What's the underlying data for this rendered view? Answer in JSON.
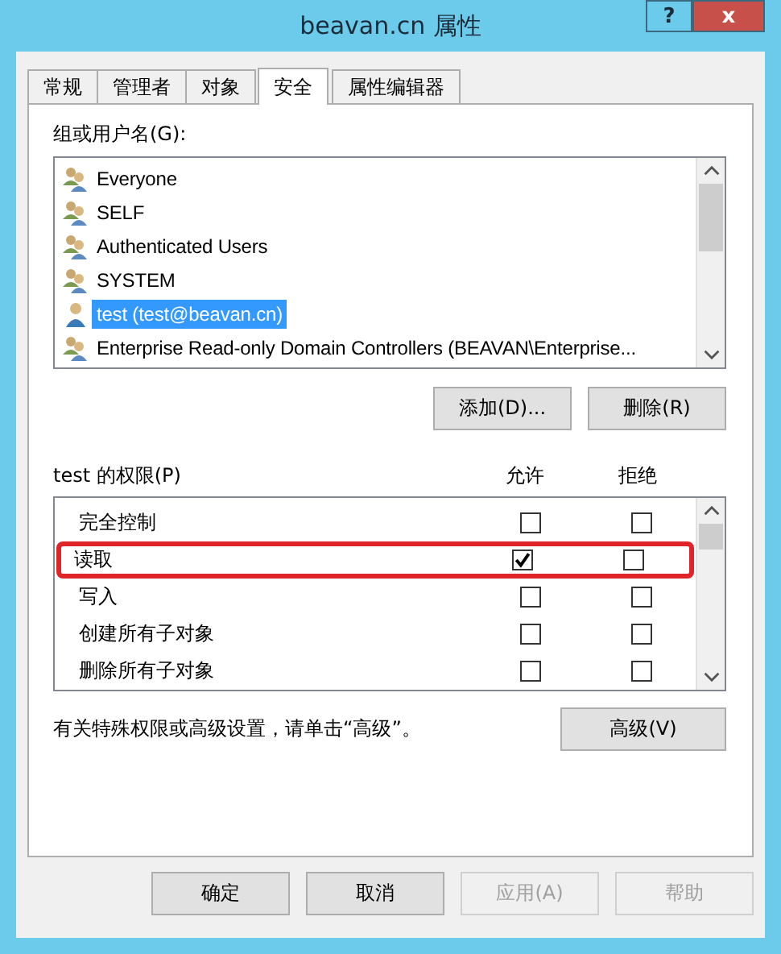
{
  "window": {
    "title": "beavan.cn 属性",
    "help_button": "?",
    "close_button": "x"
  },
  "tabs": [
    {
      "label": "常规",
      "selected": false
    },
    {
      "label": "管理者",
      "selected": false
    },
    {
      "label": "对象",
      "selected": false
    },
    {
      "label": "安全",
      "selected": true
    },
    {
      "label": "属性编辑器",
      "selected": false
    }
  ],
  "users_label": "组或用户名(G):",
  "users": [
    {
      "name": "Everyone",
      "kind": "group",
      "selected": false
    },
    {
      "name": "SELF",
      "kind": "group",
      "selected": false
    },
    {
      "name": "Authenticated Users",
      "kind": "group",
      "selected": false
    },
    {
      "name": "SYSTEM",
      "kind": "group",
      "selected": false
    },
    {
      "name": "test (test@beavan.cn)",
      "kind": "user",
      "selected": true
    },
    {
      "name": "Enterprise Read-only Domain Controllers (BEAVAN\\Enterprise...",
      "kind": "group",
      "selected": false
    }
  ],
  "user_buttons": [
    "添加(D)...",
    "删除(R)"
  ],
  "permissions_label": "test 的权限(P)",
  "allow_header": "允许",
  "deny_header": "拒绝",
  "permissions": [
    {
      "name": "完全控制",
      "allow": false,
      "deny": false,
      "highlighted": false
    },
    {
      "name": "读取",
      "allow": true,
      "deny": false,
      "highlighted": true
    },
    {
      "name": "写入",
      "allow": false,
      "deny": false,
      "highlighted": false
    },
    {
      "name": "创建所有子对象",
      "allow": false,
      "deny": false,
      "highlighted": false
    },
    {
      "name": "删除所有子对象",
      "allow": false,
      "deny": false,
      "highlighted": false
    }
  ],
  "advanced_note": "有关特殊权限或高级设置，请单击“高级”。",
  "advanced_button": "高级(V)",
  "dialog_buttons": [
    {
      "label": "确定",
      "disabled": false
    },
    {
      "label": "取消",
      "disabled": false
    },
    {
      "label": "应用(A)",
      "disabled": true
    },
    {
      "label": "帮助",
      "disabled": true
    }
  ]
}
